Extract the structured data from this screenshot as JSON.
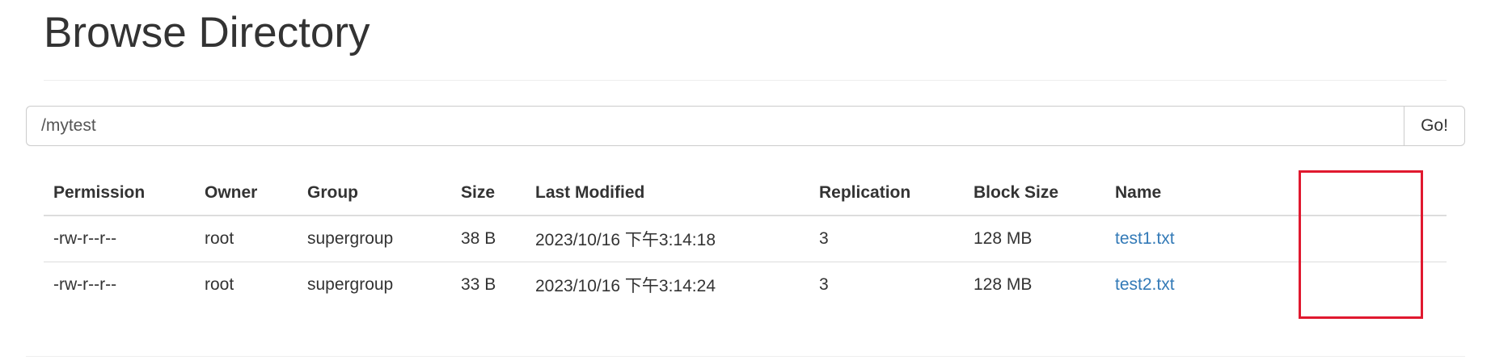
{
  "header": {
    "title": "Browse Directory"
  },
  "path_bar": {
    "value": "/mytest",
    "go_label": "Go!"
  },
  "table": {
    "columns": {
      "permission": "Permission",
      "owner": "Owner",
      "group": "Group",
      "size": "Size",
      "last_modified": "Last Modified",
      "replication": "Replication",
      "block_size": "Block Size",
      "name": "Name"
    },
    "rows": [
      {
        "permission": "-rw-r--r--",
        "owner": "root",
        "group": "supergroup",
        "size": "38 B",
        "last_modified": "2023/10/16 下午3:14:18",
        "replication": "3",
        "block_size": "128 MB",
        "name": "test1.txt"
      },
      {
        "permission": "-rw-r--r--",
        "owner": "root",
        "group": "supergroup",
        "size": "33 B",
        "last_modified": "2023/10/16 下午3:14:24",
        "replication": "3",
        "block_size": "128 MB",
        "name": "test2.txt"
      }
    ]
  },
  "colors": {
    "link": "#337ab7",
    "highlight": "#e0192f",
    "text": "#333333",
    "border": "#dddddd"
  }
}
